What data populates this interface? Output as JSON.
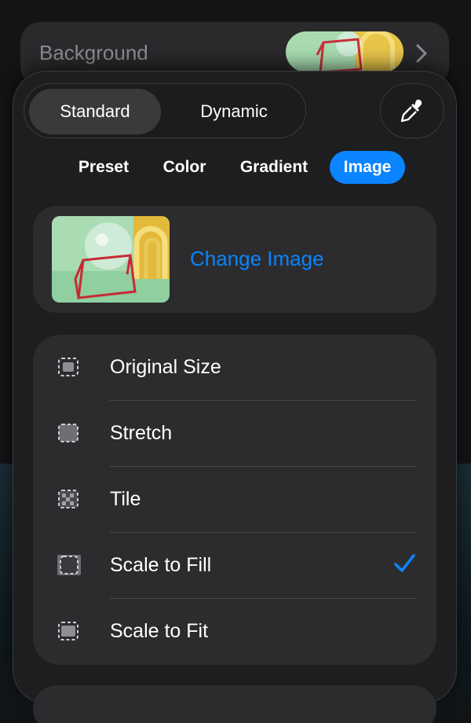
{
  "background_row": {
    "label": "Background"
  },
  "segmented": {
    "standard_label": "Standard",
    "dynamic_label": "Dynamic",
    "selected": "Standard"
  },
  "tabs": [
    {
      "label": "Preset"
    },
    {
      "label": "Color"
    },
    {
      "label": "Gradient"
    },
    {
      "label": "Image",
      "selected": true
    }
  ],
  "image_card": {
    "change_label": "Change Image"
  },
  "fill_options": [
    {
      "label": "Original Size",
      "icon": "original-size-icon",
      "checked": false
    },
    {
      "label": "Stretch",
      "icon": "stretch-icon",
      "checked": false
    },
    {
      "label": "Tile",
      "icon": "tile-icon",
      "checked": false
    },
    {
      "label": "Scale to Fill",
      "icon": "scale-to-fill-icon",
      "checked": true
    },
    {
      "label": "Scale to Fit",
      "icon": "scale-to-fit-icon",
      "checked": false
    }
  ],
  "colors": {
    "accent": "#0a84ff",
    "panel": "#2c2c2e",
    "popover": "#1e1e20",
    "secondary_text": "#8e8e93"
  }
}
